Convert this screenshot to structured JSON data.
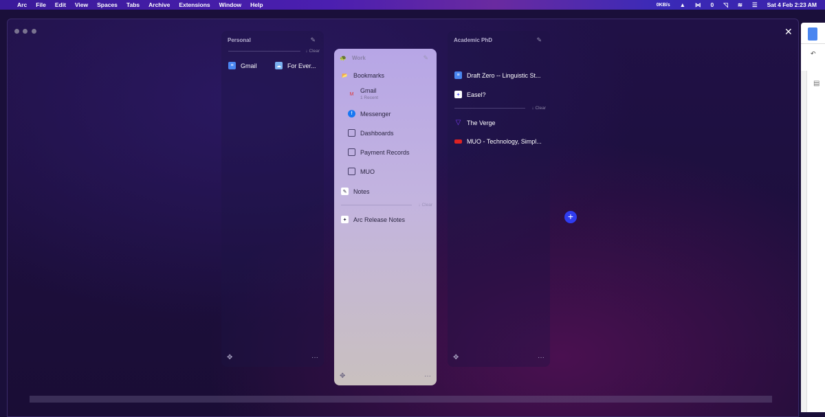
{
  "menubar": {
    "items": [
      "Arc",
      "File",
      "Edit",
      "View",
      "Spaces",
      "Tabs",
      "Archive",
      "Extensions",
      "Window",
      "Help"
    ],
    "net": "0KB/s",
    "datetime": "Sat 4 Feb  2:23 AM"
  },
  "spaces": [
    {
      "name": "Personal",
      "clear": "↓ Clear",
      "pinned": [
        {
          "label": "Gmail",
          "icon": "docs-icon"
        },
        {
          "label": "For Ever...",
          "icon": "app-icon"
        }
      ]
    },
    {
      "name": "Work",
      "folder": "Bookmarks",
      "items": [
        {
          "label": "Gmail",
          "sub": "1 Recent"
        },
        {
          "label": "Messenger"
        },
        {
          "label": "Dashboards"
        },
        {
          "label": "Payment Records"
        },
        {
          "label": "MUO"
        }
      ],
      "notes": "Notes",
      "clear": "↓ Clear",
      "tabs": [
        {
          "label": "Arc Release Notes"
        }
      ]
    },
    {
      "name": "Academic PhD",
      "pinned": [
        {
          "label": "Draft Zero -- Linguistic St..."
        },
        {
          "label": "Easel?"
        }
      ],
      "clear": "↓ Clear",
      "tabs": [
        {
          "label": "The Verge"
        },
        {
          "label": "MUO - Technology, Simpl..."
        }
      ]
    }
  ],
  "colors": {
    "accent": "#2f3cf0"
  }
}
